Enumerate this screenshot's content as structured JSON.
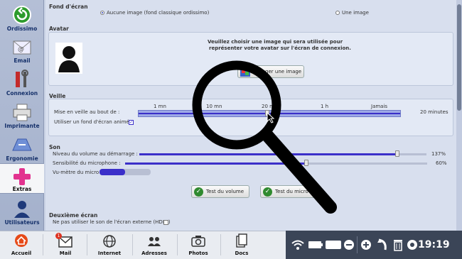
{
  "sidebar": {
    "items": [
      {
        "label": "Ordissimo",
        "icon": "back-arrow-icon"
      },
      {
        "label": "Email",
        "icon": "email-icon"
      },
      {
        "label": "Connexion",
        "icon": "tools-icon"
      },
      {
        "label": "Imprimante",
        "icon": "printer-icon"
      },
      {
        "label": "Ergonomie",
        "icon": "ergonomics-icon"
      },
      {
        "label": "Extras",
        "icon": "plus-icon"
      },
      {
        "label": "Utilisateurs",
        "icon": "user-icon"
      }
    ],
    "active": "Extras"
  },
  "wallpaper": {
    "title": "Fond d'écran",
    "option_none": "Aucune image (fond classique ordissimo)",
    "option_image": "Une image",
    "selected": "option_none"
  },
  "avatar": {
    "title": "Avatar",
    "instruction_line1": "Veuillez choisir une image qui sera utilisée pour",
    "instruction_line2": "représenter votre avatar sur l'écran de connexion.",
    "change_button": "Changer une image"
  },
  "sleep": {
    "title": "Veille",
    "label": "Mise en veille au bout de :",
    "ticks": [
      "1 mn",
      "10 mn",
      "20 mn",
      "1 h",
      "Jamais"
    ],
    "value": "20 minutes",
    "animated_bg_label": "Utiliser un fond d'écran animé.",
    "animated_bg_checked": true
  },
  "sound": {
    "title": "Son",
    "startup_label": "Niveau du volume au démarrage :",
    "startup_value": "137%",
    "startup_level": 0.9,
    "mic_label": "Sensibilité du microphone :",
    "mic_value": "60%",
    "mic_level": 0.6,
    "meter_label": "Vu-mètre du micro :",
    "test_volume": "Test du volume",
    "test_mic": "Test du micro"
  },
  "second_screen": {
    "title": "Deuxième écran",
    "hdmi_label": "Ne pas utiliser le son de l'écran externe (HDMI)"
  },
  "taskbar": {
    "items": [
      {
        "label": "Accueil",
        "icon": "home-icon"
      },
      {
        "label": "Mail",
        "icon": "mail-icon",
        "badge": "1"
      },
      {
        "label": "Internet",
        "icon": "globe-icon"
      },
      {
        "label": "Adresses",
        "icon": "contacts-icon"
      },
      {
        "label": "Photos",
        "icon": "camera-icon"
      },
      {
        "label": "Docs",
        "icon": "documents-icon"
      }
    ],
    "clock": "19:19"
  },
  "colors": {
    "accent": "#3b2fc9",
    "sidebar": "#a4b1cc",
    "content": "#d8dfee",
    "taskbar_dark": "#3b4557"
  }
}
